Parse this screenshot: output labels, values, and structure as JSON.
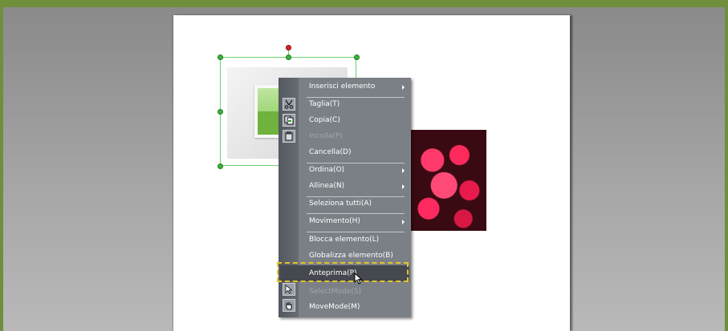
{
  "menu": {
    "items": [
      {
        "label": "Inserisci elemento",
        "submenu": true,
        "disabled": false
      },
      {
        "label": "Taglia(T)",
        "disabled": false
      },
      {
        "label": "Copia(C)",
        "disabled": false
      },
      {
        "label": "Incolla(P)",
        "disabled": true
      },
      {
        "label": "Cancella(D)",
        "disabled": false
      },
      {
        "label": "Ordina(O)",
        "submenu": true,
        "disabled": false
      },
      {
        "label": "Allinea(N)",
        "submenu": true,
        "disabled": false
      },
      {
        "label": "Seleziona tutti(A)",
        "disabled": false
      },
      {
        "label": "Movimento(H)",
        "submenu": true,
        "disabled": false
      },
      {
        "label": "Blocca elemento(L)",
        "disabled": false
      },
      {
        "label": "Globalizza elemento(B)",
        "disabled": false
      },
      {
        "label": "Anteprima(P)",
        "disabled": false,
        "highlighted": true
      },
      {
        "label": "SelectMode(S)",
        "disabled": true
      },
      {
        "label": "MoveMode(M)",
        "disabled": false
      }
    ],
    "icons": {
      "cut": "scissors-icon",
      "copy": "copy-icon",
      "paste": "paste-icon",
      "select_mode": "arrow-pointer-icon",
      "move_mode": "hand-icon"
    }
  },
  "colors": {
    "frame_border": "#6f8f3a",
    "selection": "#6fd06f",
    "rotate_handle": "#e02020",
    "menu_bg": "#7b7f86",
    "menu_highlight": "#45484e",
    "dashed_focus": "#e3c52a"
  }
}
